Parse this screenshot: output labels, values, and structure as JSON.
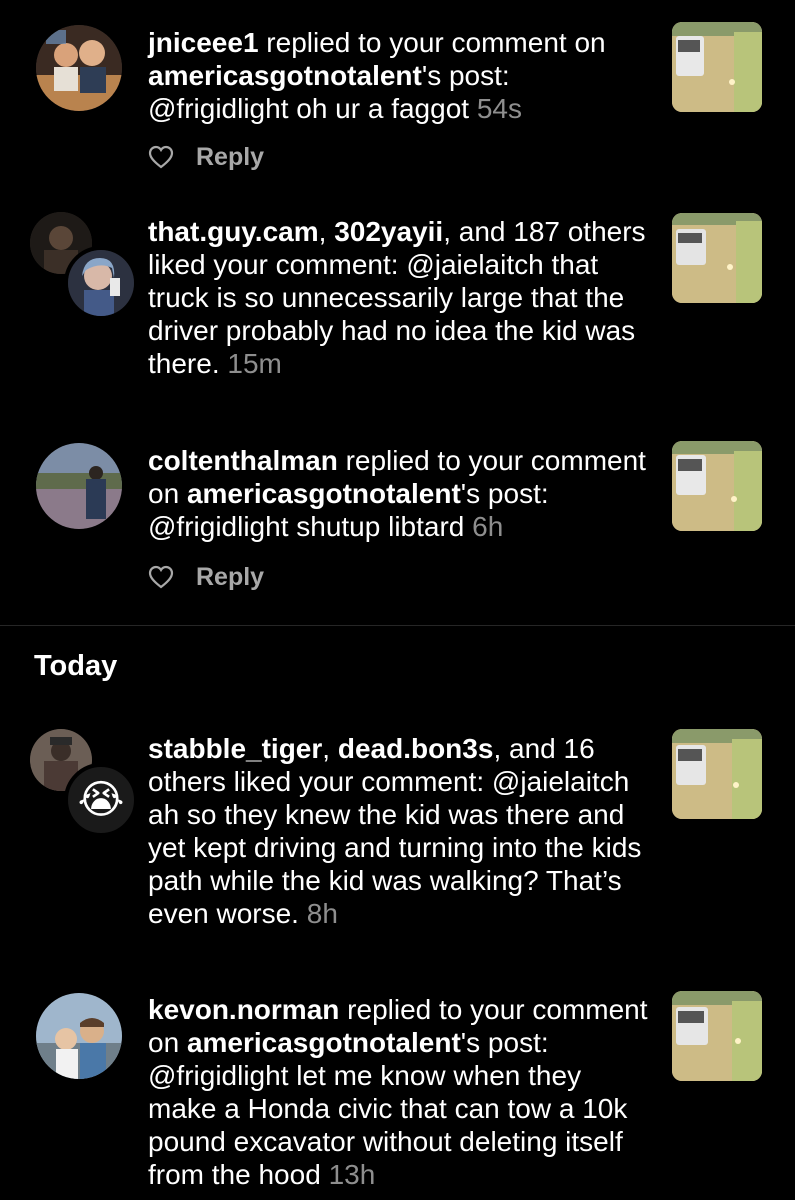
{
  "notifications": [
    {
      "user": "jniceee1",
      "action": " replied to your comment on ",
      "target": "americasgotnotalent",
      "suffix": "'s post: ",
      "body": "@frigidlight oh ur a faggot",
      "time": "54s",
      "reply_label": "Reply"
    },
    {
      "user1": "that.guy.cam",
      "sep": ", ",
      "user2": "302yayii",
      "action": ", and 187 others liked your comment: ",
      "body": "@jaielaitch that truck is so unnecessarily large that the driver probably had no idea the kid was there.",
      "time": "15m"
    },
    {
      "user": "coltenthalman",
      "action": " replied to your comment on ",
      "target": "americasgotnotalent",
      "suffix": "'s post: ",
      "body": "@frigidlight shutup libtard",
      "time": "6h",
      "reply_label": "Reply"
    },
    {
      "user1": "stabble_tiger",
      "sep": ", ",
      "user2": "dead.bon3s",
      "action": ", and 16 others liked your comment: ",
      "body": "@jaielaitch ah so they knew the kid was there and yet kept driving and turning into the kids path while the kid was walking? That’s even worse.",
      "time": "8h"
    },
    {
      "user": "kevon.norman",
      "action": " replied to your comment on ",
      "target": "americasgotnotalent",
      "suffix": "'s post: ",
      "body": "@frigidlight let me know when they make a Honda civic that can tow a 10k pound excavator without deleting itself from the hood",
      "time": "13h"
    }
  ],
  "section_today": "Today",
  "emoji": "😭",
  "icons": {
    "heart": "heart-icon"
  },
  "colors": {
    "background": "#000000",
    "text": "#ffffff",
    "secondary": "#8e8e8e",
    "reply": "#a8a8a8"
  }
}
